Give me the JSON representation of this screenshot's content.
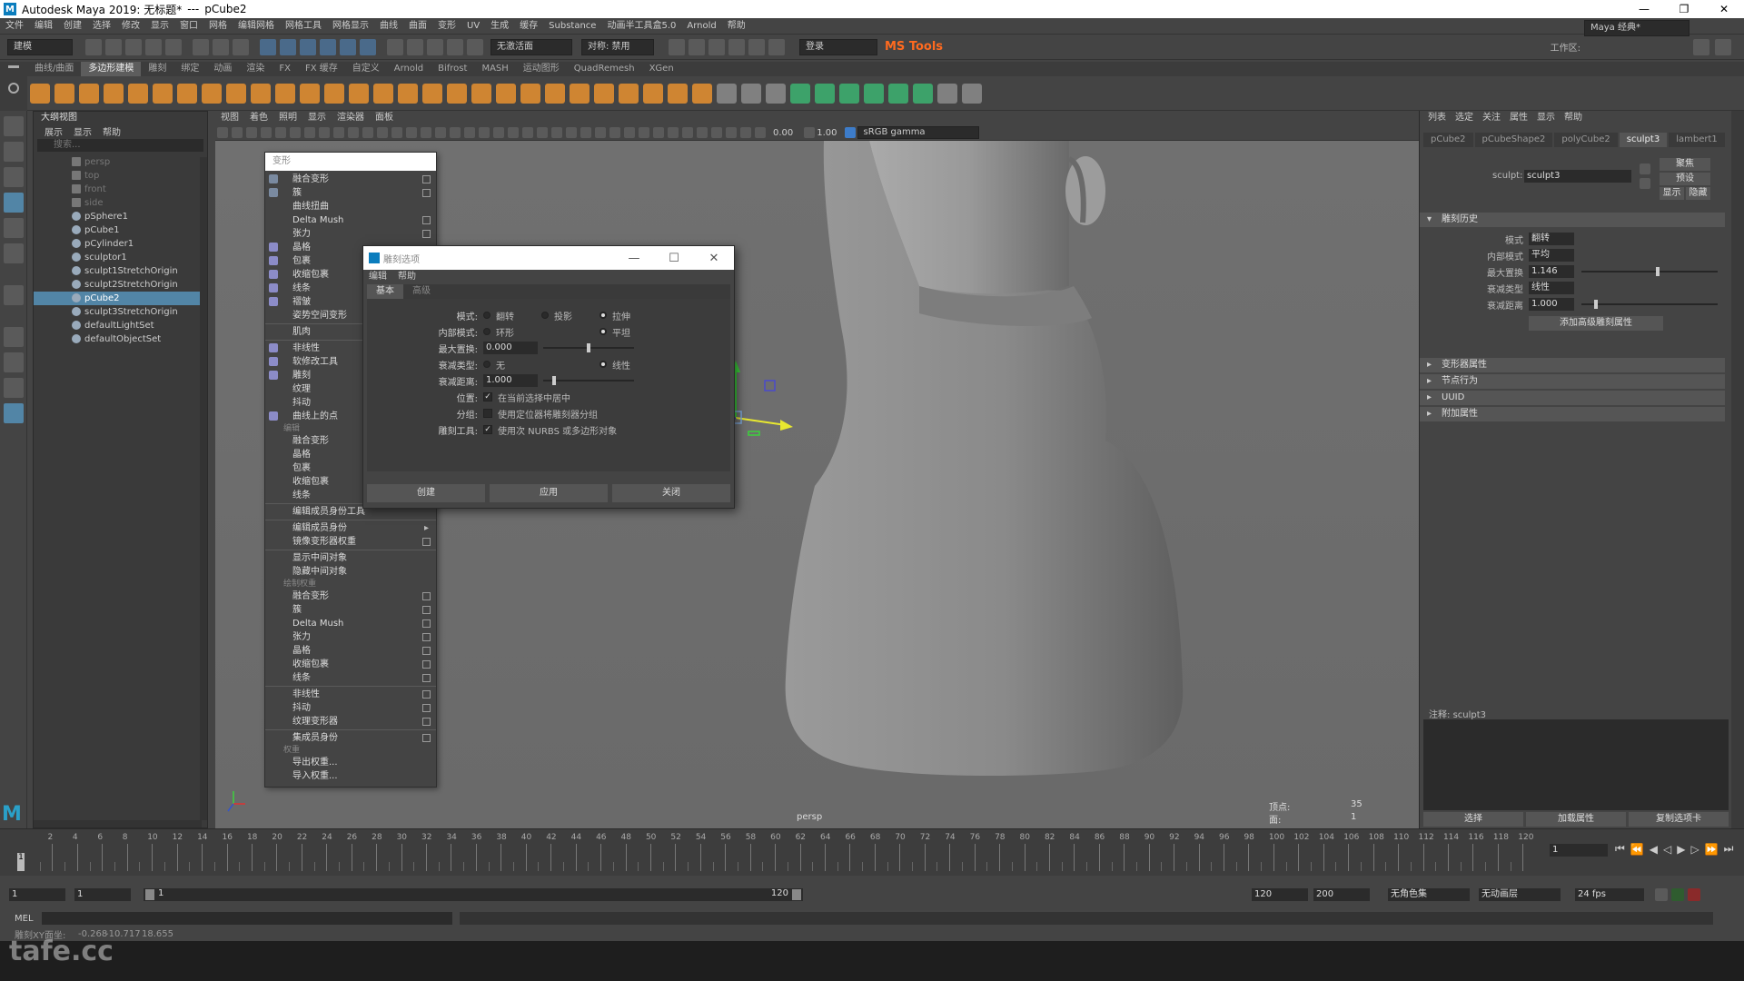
{
  "titlebar": {
    "app": "Autodesk Maya 2019: 无标题*",
    "sep": "---",
    "object": "pCube2"
  },
  "menubar": {
    "items": [
      "文件",
      "编辑",
      "创建",
      "选择",
      "修改",
      "显示",
      "窗口",
      "网格",
      "编辑网格",
      "网格工具",
      "网格显示",
      "曲线",
      "曲面",
      "变形",
      "UV",
      "生成",
      "缓存",
      "Substance",
      "动画半工具盒5.0",
      "Arnold",
      "帮助"
    ],
    "workspace_label": "工作区:",
    "workspace_value": "Maya 经典*"
  },
  "statusline": {
    "mode": "建模",
    "snap_label": "无激活面",
    "sym_label": "对称: 禁用",
    "login": "登录",
    "mstools": "MS Tools"
  },
  "shelf": {
    "tabs": [
      "曲线/曲面",
      "多边形建模",
      "雕刻",
      "绑定",
      "动画",
      "渲染",
      "FX",
      "FX 缓存",
      "自定义",
      "Arnold",
      "Bifrost",
      "MASH",
      "运动图形",
      "QuadRemesh",
      "XGen"
    ],
    "active": 1
  },
  "outliner": {
    "title": "大纲视图",
    "menu": [
      "展示",
      "显示",
      "帮助"
    ],
    "search": "搜索...",
    "items": [
      {
        "label": "persp",
        "dim": true,
        "sel": false
      },
      {
        "label": "top",
        "dim": true,
        "sel": false
      },
      {
        "label": "front",
        "dim": true,
        "sel": false
      },
      {
        "label": "side",
        "dim": true,
        "sel": false
      },
      {
        "label": "pSphere1",
        "dim": false,
        "sel": false
      },
      {
        "label": "pCube1",
        "dim": false,
        "sel": false
      },
      {
        "label": "pCylinder1",
        "dim": false,
        "sel": false
      },
      {
        "label": "sculptor1",
        "dim": false,
        "sel": false
      },
      {
        "label": "sculpt1StretchOrigin",
        "dim": false,
        "sel": false
      },
      {
        "label": "sculpt2StretchOrigin",
        "dim": false,
        "sel": false
      },
      {
        "label": "pCube2",
        "dim": false,
        "sel": true
      },
      {
        "label": "sculpt3StretchOrigin",
        "dim": false,
        "sel": false
      },
      {
        "label": "defaultLightSet",
        "dim": false,
        "sel": false
      },
      {
        "label": "defaultObjectSet",
        "dim": false,
        "sel": false
      }
    ]
  },
  "viewport": {
    "menu": [
      "视图",
      "着色",
      "照明",
      "显示",
      "渲染器",
      "面板"
    ],
    "gamma": "sRGB gamma",
    "val1": "0.00",
    "val2": "1.00",
    "camera": "persp",
    "hud_verts_label": "顶点:",
    "hud_verts": "35",
    "hud_sel_label": "面:",
    "hud_sel": "1"
  },
  "deform_menu": {
    "header": "变形",
    "items": [
      {
        "t": "item",
        "label": "融合变形",
        "box": true
      },
      {
        "t": "item",
        "label": "簇",
        "box": true
      },
      {
        "t": "item",
        "label": "曲线扭曲",
        "box": false
      },
      {
        "t": "item",
        "label": "Delta Mush",
        "box": true
      },
      {
        "t": "item",
        "label": "张力",
        "box": true
      },
      {
        "t": "item",
        "label": "晶格",
        "box": false
      },
      {
        "t": "item",
        "label": "包裹",
        "box": false
      },
      {
        "t": "item",
        "label": "收缩包裹",
        "box": false
      },
      {
        "t": "item",
        "label": "线条",
        "box": false
      },
      {
        "t": "item",
        "label": "褶皱",
        "box": false
      },
      {
        "t": "item",
        "label": "姿势空间变形",
        "box": false
      },
      {
        "t": "sep"
      },
      {
        "t": "item",
        "label": "肌肉",
        "box": false
      },
      {
        "t": "sep"
      },
      {
        "t": "item",
        "label": "非线性",
        "box": false
      },
      {
        "t": "item",
        "label": "软修改工具",
        "box": false
      },
      {
        "t": "item",
        "label": "雕刻",
        "box": false
      },
      {
        "t": "item",
        "label": "纹理",
        "box": false
      },
      {
        "t": "item",
        "label": "抖动",
        "box": false
      },
      {
        "t": "item",
        "label": "曲线上的点",
        "box": false
      },
      {
        "t": "sec",
        "label": "编辑"
      },
      {
        "t": "item",
        "label": "融合变形",
        "box": false
      },
      {
        "t": "item",
        "label": "晶格",
        "box": false
      },
      {
        "t": "item",
        "label": "包裹",
        "box": false
      },
      {
        "t": "item",
        "label": "收缩包裹",
        "box": false
      },
      {
        "t": "item",
        "label": "线条",
        "box": false
      },
      {
        "t": "sep"
      },
      {
        "t": "item",
        "label": "编辑成员身份工具",
        "box": false
      },
      {
        "t": "sep"
      },
      {
        "t": "item",
        "label": "编辑成员身份",
        "box": false,
        "arrow": true
      },
      {
        "t": "item",
        "label": "镜像变形器权重",
        "box": true
      },
      {
        "t": "sep"
      },
      {
        "t": "item",
        "label": "显示中间对象",
        "box": false
      },
      {
        "t": "item",
        "label": "隐藏中间对象",
        "box": false
      },
      {
        "t": "sec",
        "label": "绘制权重"
      },
      {
        "t": "item",
        "label": "融合变形",
        "box": true
      },
      {
        "t": "item",
        "label": "簇",
        "box": true
      },
      {
        "t": "item",
        "label": "Delta Mush",
        "box": true
      },
      {
        "t": "item",
        "label": "张力",
        "box": true
      },
      {
        "t": "item",
        "label": "晶格",
        "box": true
      },
      {
        "t": "item",
        "label": "收缩包裹",
        "box": true
      },
      {
        "t": "item",
        "label": "线条",
        "box": true
      },
      {
        "t": "sep"
      },
      {
        "t": "item",
        "label": "非线性",
        "box": true
      },
      {
        "t": "item",
        "label": "抖动",
        "box": true
      },
      {
        "t": "item",
        "label": "纹理变形器",
        "box": true
      },
      {
        "t": "sep"
      },
      {
        "t": "item",
        "label": "集成员身份",
        "box": true
      },
      {
        "t": "sec",
        "label": "权重"
      },
      {
        "t": "item",
        "label": "导出权重...",
        "box": false
      },
      {
        "t": "item",
        "label": "导入权重...",
        "box": false
      }
    ]
  },
  "dialog": {
    "title": "雕刻选项",
    "menu": [
      "编辑",
      "帮助"
    ],
    "tabs": [
      "基本",
      "高级"
    ],
    "mode_label": "模式:",
    "mode_opts": [
      "翻转",
      "投影",
      "拉伸"
    ],
    "inner_label": "内部模式:",
    "inner_opts": [
      "环形",
      "平坦"
    ],
    "max_label": "最大置换:",
    "max_value": "0.000",
    "falloff_label": "衰减类型:",
    "falloff_opts": [
      "无",
      "线性"
    ],
    "dist_label": "衰减距离:",
    "dist_value": "1.000",
    "pos_label": "位置:",
    "pos_text": "在当前选择中居中",
    "group_label": "分组:",
    "group_text": "使用定位器将雕刻器分组",
    "tool_label": "雕刻工具:",
    "tool_text": "使用次 NURBS 或多边形对象",
    "btn_create": "创建",
    "btn_apply": "应用",
    "btn_close": "关闭"
  },
  "attr": {
    "menu": [
      "列表",
      "选定",
      "关注",
      "属性",
      "显示",
      "帮助"
    ],
    "tabs": [
      "pCube2",
      "pCubeShape2",
      "polyCube2",
      "sculpt3",
      "lambert1"
    ],
    "active_tab": 3,
    "sculpt_label": "sculpt:",
    "sculpt_value": "sculpt3",
    "btn_focus": "聚焦",
    "btn_preset": "预设",
    "btn_show": "显示",
    "btn_hide": "隐藏",
    "sec_hist": "雕刻历史",
    "mode_label": "模式",
    "mode_val": "翻转",
    "inner_label": "内部模式",
    "inner_val": "平均",
    "max_label": "最大置换",
    "max_val": "1.146",
    "fall_label": "衰减类型",
    "fall_val": "线性",
    "dist_label": "衰减距离",
    "dist_val": "1.000",
    "add_btn": "添加高级雕刻属性",
    "sections": [
      "变形器属性",
      "节点行为",
      "UUID",
      "附加属性"
    ],
    "notes_label": "注释:",
    "notes_value": "sculpt3",
    "btn_select": "选择",
    "btn_load": "加载属性",
    "btn_copy": "复制选项卡"
  },
  "timeline": {
    "ticks": [
      "2",
      "4",
      "6",
      "8",
      "10",
      "12",
      "14",
      "16",
      "18",
      "20",
      "22",
      "24",
      "26",
      "28",
      "30",
      "32",
      "34",
      "36",
      "38",
      "40",
      "42",
      "44",
      "46",
      "48",
      "50",
      "52",
      "54",
      "56",
      "58",
      "60",
      "62",
      "64",
      "66",
      "68",
      "70",
      "72",
      "74",
      "76",
      "78",
      "80",
      "82",
      "84",
      "86",
      "88",
      "90",
      "92",
      "94",
      "96",
      "98",
      "100",
      "102",
      "104",
      "106",
      "108",
      "110",
      "112",
      "114",
      "116",
      "118",
      "120"
    ],
    "current": "1",
    "frame_field": "1"
  },
  "range": {
    "start": "1",
    "start2": "1",
    "inner_start": "1",
    "inner_end": "120",
    "end": "120",
    "end2": "200",
    "char_set": "无角色集",
    "anim_layer": "无动画层",
    "fps": "24 fps"
  },
  "cmdline": {
    "label": "MEL"
  },
  "helpline": {
    "values": [
      "-0.268",
      "-10.717",
      "18.655"
    ],
    "label": "雕刻XY面坐:"
  },
  "watermark": "tafe.cc"
}
